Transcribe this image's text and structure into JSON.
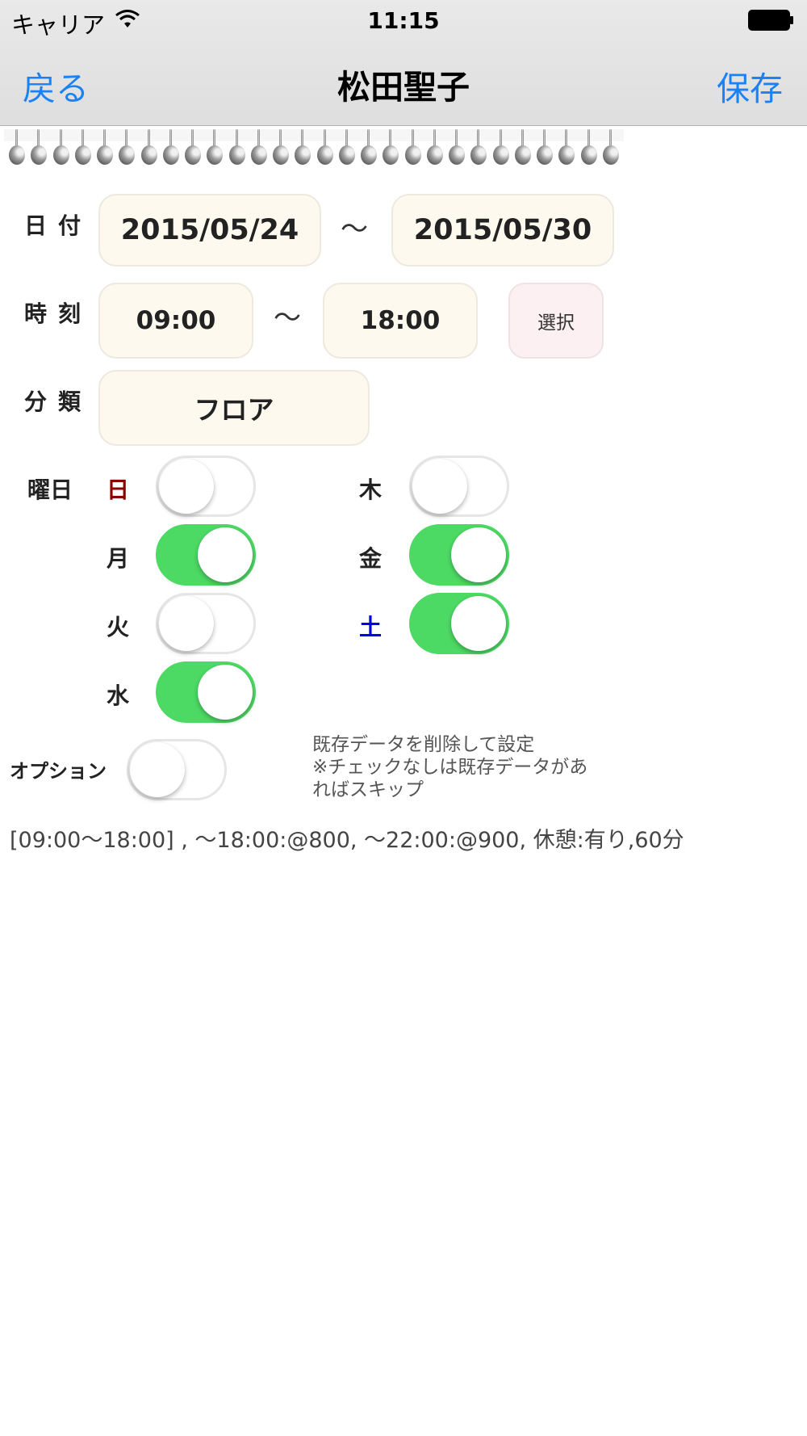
{
  "status_bar": {
    "carrier": "キャリア",
    "time": "11:15"
  },
  "nav": {
    "back": "戻る",
    "title": "松田聖子",
    "save": "保存"
  },
  "form": {
    "date_label": "日付",
    "date_from": "2015/05/24",
    "date_sep": "〜",
    "date_to": "2015/05/30",
    "time_label": "時刻",
    "time_from": "09:00",
    "time_sep": "〜",
    "time_to": "18:00",
    "select_button": "選択",
    "category_label": "分類",
    "category_value": "フロア",
    "weekday_label": "曜日",
    "days": {
      "sun": {
        "label": "日",
        "on": false
      },
      "mon": {
        "label": "月",
        "on": true
      },
      "tue": {
        "label": "火",
        "on": false
      },
      "wed": {
        "label": "水",
        "on": true
      },
      "thu": {
        "label": "木",
        "on": false
      },
      "fri": {
        "label": "金",
        "on": true
      },
      "sat": {
        "label": "土",
        "on": true
      }
    },
    "option_label": "オプション",
    "option_on": false,
    "option_note_1": "既存データを削除して設定",
    "option_note_2": "※チェックなしは既存データがあ",
    "option_note_3": "ればスキップ"
  },
  "summary": "[09:00〜18:00] , 〜18:00:@800, 〜22:00:@900, 休憩:有り,60分",
  "colors": {
    "accent": "#1a82f7",
    "toggle_on": "#4cd964",
    "sunday": "#8b0000",
    "saturday": "#0000e0"
  }
}
